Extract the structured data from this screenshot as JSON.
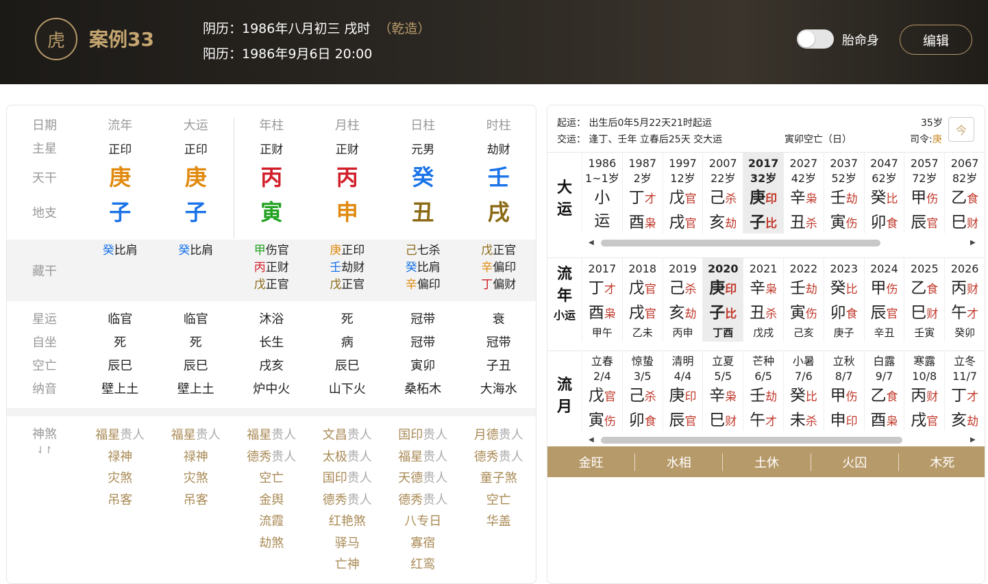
{
  "header": {
    "logo_icon": "tiger-logo-icon",
    "title": "案例33",
    "lunar": "阴历：1986年八月初三 戌时",
    "lunar_tag": "（乾造）",
    "solar": "阳历：1986年9月6日 20:00",
    "toggle_label": "胎命身",
    "toggle_on": false,
    "edit_label": "编辑"
  },
  "colors": {
    "wood": "#22a322",
    "fire": "#d1202a",
    "earth": "#8b6914",
    "metal": "#e08a10",
    "water": "#1a73e8",
    "gold": "#b79a6a"
  },
  "pillars": {
    "labels": [
      "日期",
      "流年",
      "大运",
      "年柱",
      "月柱",
      "日柱",
      "时柱"
    ],
    "zhuxing": {
      "label": "主星",
      "values": [
        "正印",
        "正印",
        "正财",
        "正财",
        "元男",
        "劫财"
      ]
    },
    "tiangan": {
      "label": "天干",
      "values": [
        "庚",
        "庚",
        "丙",
        "丙",
        "癸",
        "壬"
      ]
    },
    "dizhi": {
      "label": "地支",
      "values": [
        "子",
        "子",
        "寅",
        "申",
        "丑",
        "戌"
      ]
    },
    "canggan_label": "藏干",
    "canggan": [
      [
        {
          "g": "癸",
          "s": "比肩"
        }
      ],
      [
        {
          "g": "癸",
          "s": "比肩"
        }
      ],
      [
        {
          "g": "甲",
          "s": "伤官"
        },
        {
          "g": "丙",
          "s": "正财"
        },
        {
          "g": "戊",
          "s": "正官"
        }
      ],
      [
        {
          "g": "庚",
          "s": "正印"
        },
        {
          "g": "壬",
          "s": "劫财"
        },
        {
          "g": "戊",
          "s": "正官"
        }
      ],
      [
        {
          "g": "己",
          "s": "七杀"
        },
        {
          "g": "癸",
          "s": "比肩"
        },
        {
          "g": "辛",
          "s": "偏印"
        }
      ],
      [
        {
          "g": "戊",
          "s": "正官"
        },
        {
          "g": "辛",
          "s": "偏印"
        },
        {
          "g": "丁",
          "s": "偏财"
        }
      ]
    ],
    "xingyun": {
      "label": "星运",
      "values": [
        "临官",
        "临官",
        "沐浴",
        "死",
        "冠带",
        "衰"
      ]
    },
    "zizuo": {
      "label": "自坐",
      "values": [
        "死",
        "死",
        "长生",
        "病",
        "冠带",
        "冠带"
      ]
    },
    "kongwang": {
      "label": "空亡",
      "values": [
        "辰巳",
        "辰巳",
        "戌亥",
        "辰巳",
        "寅卯",
        "子丑"
      ]
    },
    "nayin": {
      "label": "纳音",
      "values": [
        "壁上土",
        "壁上土",
        "炉中火",
        "山下火",
        "桑柘木",
        "大海水"
      ]
    },
    "shensha_label": "神煞",
    "shensha_toggle": "⇃↾",
    "shensha": [
      [
        "福星贵人",
        "禄神",
        "灾煞",
        "吊客"
      ],
      [
        "福星贵人",
        "禄神",
        "灾煞",
        "吊客"
      ],
      [
        "福星贵人",
        "德秀贵人",
        "空亡",
        "金舆",
        "流霞",
        "劫煞"
      ],
      [
        "文昌贵人",
        "太极贵人",
        "国印贵人",
        "德秀贵人",
        "红艳煞",
        "驿马",
        "亡神"
      ],
      [
        "国印贵人",
        "福星贵人",
        "天德贵人",
        "德秀贵人",
        "八专日",
        "寡宿",
        "红鸾"
      ],
      [
        "月德贵人",
        "德秀贵人",
        "童子煞",
        "空亡",
        "华盖"
      ]
    ]
  },
  "info": {
    "qiyun": "起运：  出生后0年5月22天21时起运",
    "jiaoyun": "交运：  逢丁、壬年 立春后25天 交大运",
    "kong": "寅卯空亡（日）",
    "age": "35岁",
    "siling_label": "司令:",
    "siling_value": "庚",
    "cal_icon": "calendar-today-icon",
    "cal_text": "今"
  },
  "dayun": {
    "title": "大运",
    "items": [
      {
        "year": "1986",
        "age": "1~1岁",
        "g": "小",
        "gs": "",
        "z": "运",
        "zs": ""
      },
      {
        "year": "1987",
        "age": "2岁",
        "g": "丁",
        "gs": "才",
        "z": "酉",
        "zs": "枭"
      },
      {
        "year": "1997",
        "age": "12岁",
        "g": "戊",
        "gs": "官",
        "z": "戌",
        "zs": "官"
      },
      {
        "year": "2007",
        "age": "22岁",
        "g": "己",
        "gs": "杀",
        "z": "亥",
        "zs": "劫"
      },
      {
        "year": "2017",
        "age": "32岁",
        "g": "庚",
        "gs": "印",
        "z": "子",
        "zs": "比"
      },
      {
        "year": "2027",
        "age": "42岁",
        "g": "辛",
        "gs": "枭",
        "z": "丑",
        "zs": "杀"
      },
      {
        "year": "2037",
        "age": "52岁",
        "g": "壬",
        "gs": "劫",
        "z": "寅",
        "zs": "伤"
      },
      {
        "year": "2047",
        "age": "62岁",
        "g": "癸",
        "gs": "比",
        "z": "卯",
        "zs": "食"
      },
      {
        "year": "2057",
        "age": "72岁",
        "g": "甲",
        "gs": "伤",
        "z": "辰",
        "zs": "官"
      },
      {
        "year": "2067",
        "age": "82岁",
        "g": "乙",
        "gs": "食",
        "z": "巳",
        "zs": "财"
      }
    ]
  },
  "liunian": {
    "title1": "流",
    "title2": "年",
    "title3": "小运",
    "items": [
      {
        "year": "2017",
        "g": "丁",
        "gs": "才",
        "z": "酉",
        "zs": "枭",
        "xy": "甲午"
      },
      {
        "year": "2018",
        "g": "戊",
        "gs": "官",
        "z": "戌",
        "zs": "官",
        "xy": "乙未"
      },
      {
        "year": "2019",
        "g": "己",
        "gs": "杀",
        "z": "亥",
        "zs": "劫",
        "xy": "丙申"
      },
      {
        "year": "2020",
        "g": "庚",
        "gs": "印",
        "z": "子",
        "zs": "比",
        "xy": "丁酉"
      },
      {
        "year": "2021",
        "g": "辛",
        "gs": "枭",
        "z": "丑",
        "zs": "杀",
        "xy": "戊戌"
      },
      {
        "year": "2022",
        "g": "壬",
        "gs": "劫",
        "z": "寅",
        "zs": "伤",
        "xy": "己亥"
      },
      {
        "year": "2023",
        "g": "癸",
        "gs": "比",
        "z": "卯",
        "zs": "食",
        "xy": "庚子"
      },
      {
        "year": "2024",
        "g": "甲",
        "gs": "伤",
        "z": "辰",
        "zs": "官",
        "xy": "辛丑"
      },
      {
        "year": "2025",
        "g": "乙",
        "gs": "食",
        "z": "巳",
        "zs": "财",
        "xy": "壬寅"
      },
      {
        "year": "2026",
        "g": "丙",
        "gs": "财",
        "z": "午",
        "zs": "才",
        "xy": "癸卯"
      }
    ]
  },
  "liuyue": {
    "title": "流月",
    "items": [
      {
        "jie": "立春",
        "date": "2/4",
        "g": "戊",
        "gs": "官",
        "z": "寅",
        "zs": "伤"
      },
      {
        "jie": "惊蛰",
        "date": "3/5",
        "g": "己",
        "gs": "杀",
        "z": "卯",
        "zs": "食"
      },
      {
        "jie": "清明",
        "date": "4/4",
        "g": "庚",
        "gs": "印",
        "z": "辰",
        "zs": "官"
      },
      {
        "jie": "立夏",
        "date": "5/5",
        "g": "辛",
        "gs": "枭",
        "z": "巳",
        "zs": "财"
      },
      {
        "jie": "芒种",
        "date": "6/5",
        "g": "壬",
        "gs": "劫",
        "z": "午",
        "zs": "才"
      },
      {
        "jie": "小暑",
        "date": "7/6",
        "g": "癸",
        "gs": "比",
        "z": "未",
        "zs": "杀"
      },
      {
        "jie": "立秋",
        "date": "8/7",
        "g": "甲",
        "gs": "伤",
        "z": "申",
        "zs": "印"
      },
      {
        "jie": "白露",
        "date": "9/7",
        "g": "乙",
        "gs": "食",
        "z": "酉",
        "zs": "枭"
      },
      {
        "jie": "寒露",
        "date": "10/8",
        "g": "丙",
        "gs": "财",
        "z": "戌",
        "zs": "官"
      },
      {
        "jie": "立冬",
        "date": "11/7",
        "g": "丁",
        "gs": "才",
        "z": "亥",
        "zs": "劫"
      }
    ]
  },
  "seasons": [
    "金旺",
    "水相",
    "土休",
    "火囚",
    "木死"
  ]
}
